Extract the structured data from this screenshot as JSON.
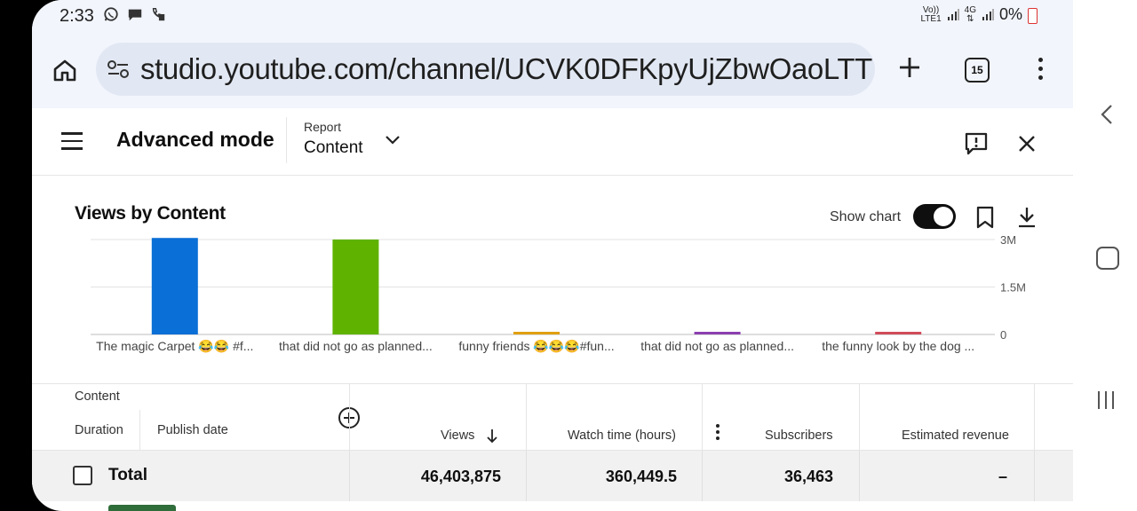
{
  "status_bar": {
    "time": "2:33",
    "left_icons": [
      "whatsapp-icon",
      "message-icon",
      "call-forward-icon"
    ],
    "network_top": "Vo))",
    "network_bottom": "LTE1",
    "net_type": "4G",
    "battery_text": "0%"
  },
  "browser": {
    "url": "studio.youtube.com/channel/UCVK0DFKpyUjZbwOaoLTT",
    "tab_count": "15"
  },
  "studio_header": {
    "mode_title": "Advanced mode",
    "report_label": "Report",
    "report_value": "Content"
  },
  "chart_header": {
    "title": "Views by Content",
    "show_chart_label": "Show chart",
    "show_chart_on": true
  },
  "chart_data": {
    "type": "bar",
    "title": "Views by Content",
    "categories": [
      "The magic Carpet 😂😂 #f...",
      "that did not go as planned...",
      "funny friends 😂😂😂#fun...",
      "that did not go as planned...",
      "the funny look by the dog ..."
    ],
    "values": [
      3050000,
      3000000,
      70000,
      55000,
      50000
    ],
    "colors": [
      "#0a6fd6",
      "#5fb300",
      "#e0a010",
      "#8b3fb0",
      "#d04b5a"
    ],
    "ytick_values": [
      0,
      1500000,
      3000000
    ],
    "ytick_labels": [
      "0",
      "1.5M",
      "3M"
    ],
    "ylim": [
      0,
      3000000
    ],
    "grid": true
  },
  "table": {
    "headers": {
      "content": "Content",
      "duration": "Duration",
      "publish_date": "Publish date",
      "views": "Views",
      "watch_time": "Watch time (hours)",
      "subscribers": "Subscribers",
      "revenue": "Estimated revenue"
    },
    "total": {
      "label": "Total",
      "views": "46,403,875",
      "watch_time": "360,449.5",
      "subscribers": "36,463",
      "revenue": "–"
    }
  }
}
